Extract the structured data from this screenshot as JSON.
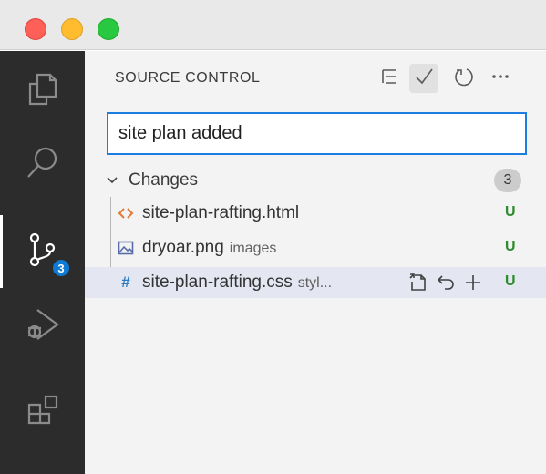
{
  "window": {
    "controls": [
      "close",
      "minimize",
      "zoom"
    ]
  },
  "activity_bar": {
    "items": [
      {
        "name": "explorer",
        "icon": "files-icon"
      },
      {
        "name": "search",
        "icon": "search-icon"
      },
      {
        "name": "source-control",
        "icon": "source-control-icon",
        "badge": "3",
        "active": true
      },
      {
        "name": "run-and-debug",
        "icon": "debug-icon"
      },
      {
        "name": "extensions",
        "icon": "extensions-icon"
      }
    ]
  },
  "sidebar": {
    "title": "SOURCE CONTROL",
    "actions": [
      "view-as-tree-icon",
      "commit-check-icon",
      "refresh-icon",
      "more-actions-icon"
    ],
    "commit_message": "site plan added",
    "changes": {
      "label": "Changes",
      "count": "3",
      "files": [
        {
          "name": "site-plan-rafting.html",
          "dir": "",
          "status": "U",
          "icon": "html-file-icon",
          "icon_color": "#e37933"
        },
        {
          "name": "dryoar.png",
          "dir": "images",
          "status": "U",
          "icon": "image-file-icon",
          "icon_color": "#5a6ca8"
        },
        {
          "name": "site-plan-rafting.css",
          "dir": "styl...",
          "status": "U",
          "icon": "css-file-icon",
          "icon_color": "#2f7bbf",
          "selected": true
        }
      ]
    }
  }
}
